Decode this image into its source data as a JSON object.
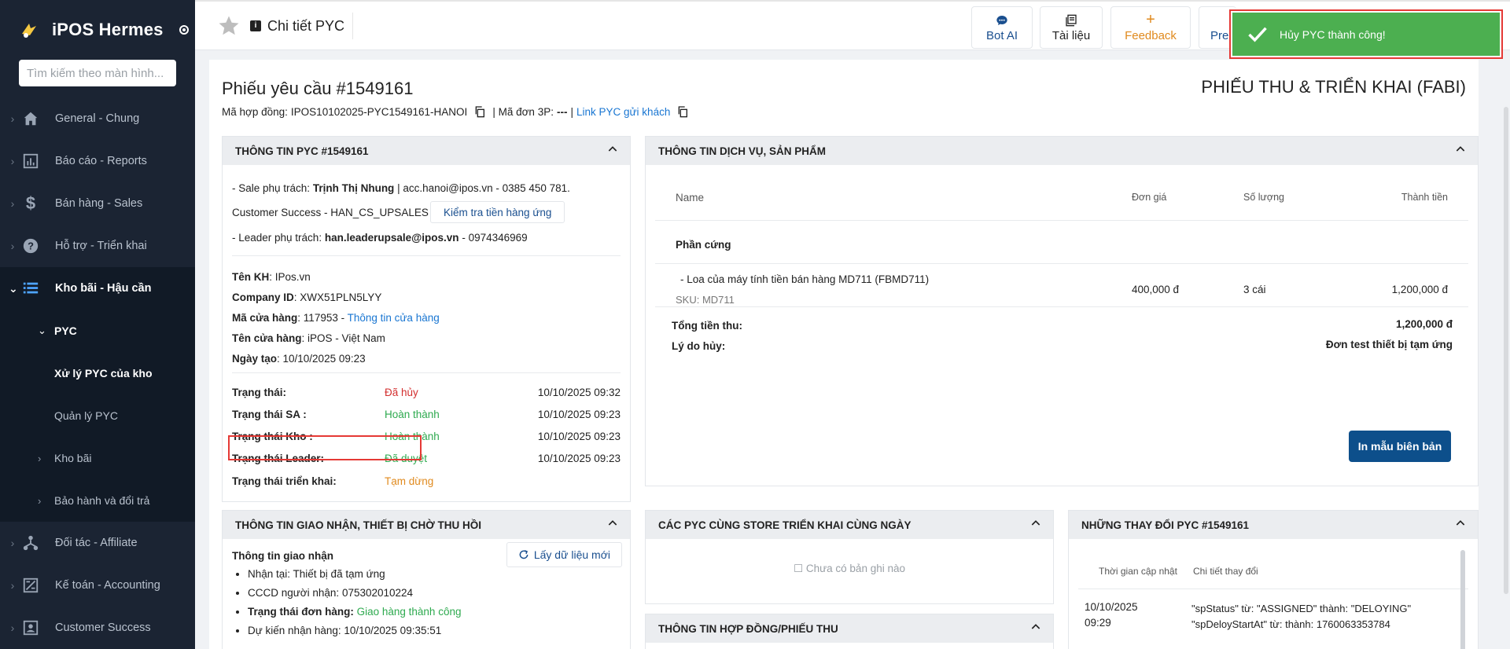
{
  "sidebar": {
    "brand": "iPOS Hermes",
    "search_placeholder": "Tìm kiếm theo màn hình...",
    "items": [
      {
        "label": "General - Chung"
      },
      {
        "label": "Báo cáo - Reports"
      },
      {
        "label": "Bán hàng - Sales"
      },
      {
        "label": "Hỗ trợ - Triển khai"
      },
      {
        "label": "Kho bãi - Hậu cần"
      },
      {
        "label": "PYC"
      },
      {
        "label": "Xử lý PYC của kho"
      },
      {
        "label": "Quản lý PYC"
      },
      {
        "label": "Kho bãi"
      },
      {
        "label": "Bảo hành và đổi trả"
      },
      {
        "label": "Đối tác - Affiliate"
      },
      {
        "label": "Kế toán - Accounting"
      },
      {
        "label": "Customer Success"
      }
    ]
  },
  "topbar": {
    "title": "Chi tiết PYC",
    "buttons": [
      {
        "label": "Bot AI"
      },
      {
        "label": "Tài liệu"
      },
      {
        "label": "Feedback"
      },
      {
        "label": "Pre"
      }
    ]
  },
  "toast": {
    "message": "Hủy PYC thành công!"
  },
  "page": {
    "title": "Phiếu yêu cầu #1549161",
    "type_title": "PHIẾU THU & TRIỂN KHAI (FABI)",
    "contract_label": "Mã hợp đồng:",
    "contract_value": "IPOS10102025-PYC1549161-HANOI",
    "order_label": "| Mã đơn 3P:",
    "order_value": "---",
    "sep": "|",
    "link_label": "Link PYC gửi khách"
  },
  "pyc_info": {
    "header": "THÔNG TIN PYC #1549161",
    "sale_prefix": "- Sale phụ trách:",
    "sale_name": "Trịnh Thị Nhung",
    "sale_contact": "| acc.hanoi@ipos.vn - 0385 450 781.",
    "cs_text": "Customer Success - HAN_CS_UPSALES",
    "check_button": "Kiểm tra tiền hàng ứng",
    "leader_prefix": "- Leader phụ trách:",
    "leader_email": "han.leaderupsale@ipos.vn",
    "leader_phone": "- 0974346969",
    "customer_label": "Tên KH",
    "customer_value": ": IPos.vn",
    "company_label": "Company ID",
    "company_value": ": XWX51PLN5LYY",
    "store_code_label": "Mã cửa hàng",
    "store_code_value": ": 117953 -",
    "store_link": "Thông tin cửa hàng",
    "store_name_label": "Tên cửa hàng",
    "store_name_value": ": iPOS - Việt Nam",
    "created_label": "Ngày tạo",
    "created_value": ": 10/10/2025 09:23",
    "statuses": [
      {
        "key": "Trạng thái:",
        "value": "Đã hủy",
        "time": "10/10/2025 09:32"
      },
      {
        "key": "Trạng thái SA :",
        "value": "Hoàn thành",
        "time": "10/10/2025 09:23"
      },
      {
        "key": "Trạng thái Kho :",
        "value": "Hoàn thành",
        "time": "10/10/2025 09:23"
      },
      {
        "key": "Trạng thái Leader:",
        "value": "Đã duyệt",
        "time": "10/10/2025 09:23"
      },
      {
        "key": "Trạng thái triển khai:",
        "value": "Tạm dừng",
        "time": ""
      }
    ]
  },
  "service_info": {
    "header": "THÔNG TIN DỊCH VỤ, SẢN PHẨM",
    "columns": [
      "Name",
      "Đơn giá",
      "Số lượng",
      "Thành tiền"
    ],
    "group": "Phần cứng",
    "item_name": "- Loa của máy tính tiền bán hàng MD711 (FBMD711)",
    "item_sku": "SKU: MD711",
    "item_price": "400,000 đ",
    "item_qty": "3 cái",
    "item_total": "1,200,000 đ",
    "total_label": "Tổng tiền thu:",
    "total_value": "1,200,000 đ",
    "cancel_label": "Lý do hủy:",
    "cancel_value": "Đơn test thiết bị tạm ứng",
    "print_button": "In mẫu biên bản"
  },
  "delivery_info": {
    "header": "THÔNG TIN GIAO NHẬN, THIẾT BỊ CHỜ THU HỒI",
    "subtitle": "Thông tin giao nhận",
    "refresh_button": "Lấy dữ liệu mới",
    "received_at": "Nhận tại: Thiết bị đã tạm ứng",
    "cccd": "CCCD người nhận: 075302010224",
    "order_status_label": "Trạng thái đơn hàng:",
    "order_status_value": "Giao hàng thành công",
    "expected": "Dự kiến nhận hàng: 10/10/2025 09:35:51"
  },
  "same_store": {
    "header": "CÁC PYC CÙNG STORE TRIỂN KHAI CÙNG NGÀY",
    "empty": "Chưa có bản ghi nào"
  },
  "contract_info": {
    "header": "THÔNG TIN HỢP ĐỒNG/PHIẾU THU"
  },
  "changes": {
    "header": "NHỮNG THAY ĐỔI PYC #1549161",
    "columns": [
      "Thời gian cập nhật",
      "Chi tiết thay đổi"
    ],
    "row_date": "10/10/2025",
    "row_time": "09:29",
    "row_line1": "\"spStatus\" từ: \"ASSIGNED\" thành: \"DELOYING\"",
    "row_line2": "\"spDeloyStartAt\" từ: thành: 1760063353784"
  }
}
